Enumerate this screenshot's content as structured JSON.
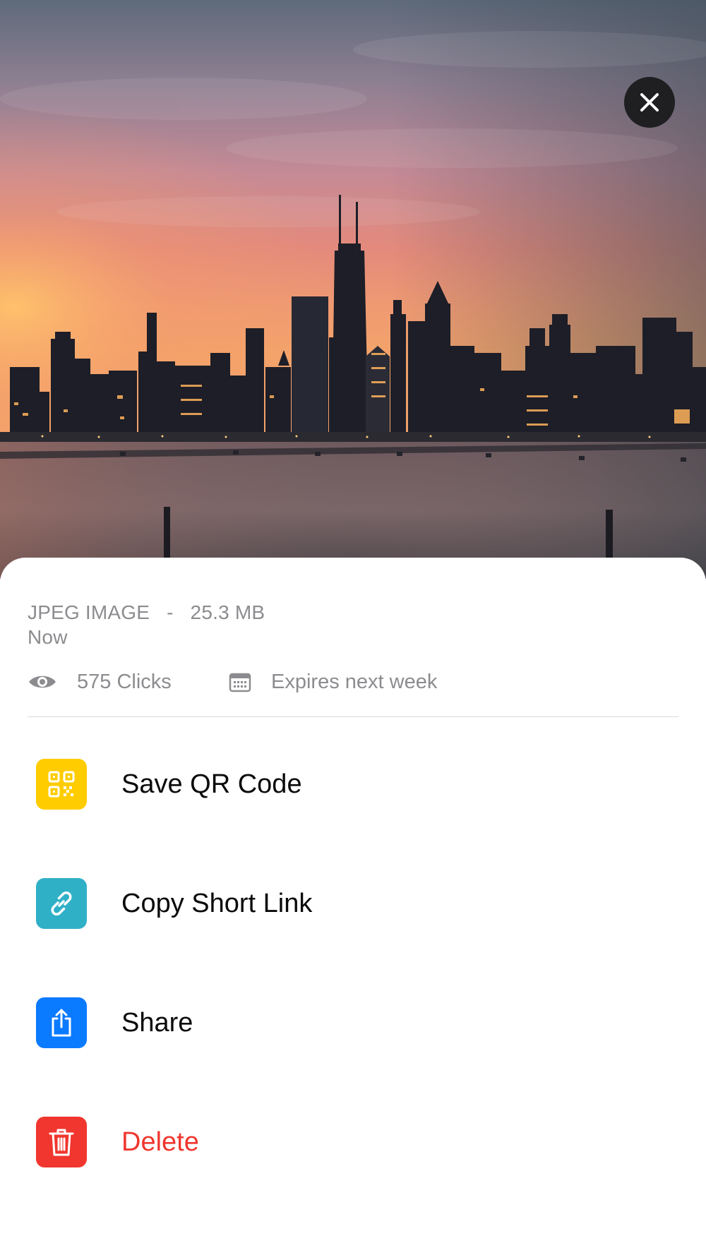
{
  "file": {
    "type_line": "JPEG IMAGE   -   25.3 MB",
    "time": "Now"
  },
  "stats": {
    "clicks": "575 Clicks",
    "expiry": "Expires next week"
  },
  "actions": [
    {
      "label": "Save QR Code",
      "icon": "qr-code-icon",
      "color": "#FFCC00"
    },
    {
      "label": "Copy Short Link",
      "icon": "link-icon",
      "color": "#30B0C7"
    },
    {
      "label": "Share",
      "icon": "share-icon",
      "color": "#0A7AFF"
    },
    {
      "label": "Delete",
      "icon": "trash-icon",
      "color": "#F0362E"
    }
  ],
  "colors": {
    "delete_text": "#F0362E",
    "close_button": "#1F1F22",
    "muted_text": "#8C8C90"
  }
}
